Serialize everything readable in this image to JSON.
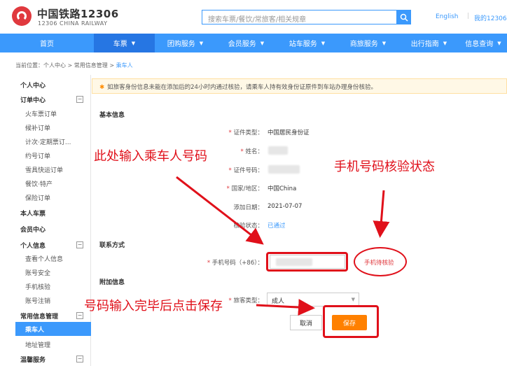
{
  "header": {
    "logo_cn": "中国铁路12306",
    "logo_en": "12306 CHINA RAILWAY",
    "search_placeholder": "搜索车票/餐饮/常旅客/相关规章",
    "english_link": "English",
    "my_link": "我的12306"
  },
  "nav": {
    "items": [
      {
        "label": "首页",
        "has_chevron": false
      },
      {
        "label": "车票",
        "has_chevron": true
      },
      {
        "label": "团购服务",
        "has_chevron": true
      },
      {
        "label": "会员服务",
        "has_chevron": true
      },
      {
        "label": "站车服务",
        "has_chevron": true
      },
      {
        "label": "商旅服务",
        "has_chevron": true
      },
      {
        "label": "出行指南",
        "has_chevron": true
      },
      {
        "label": "信息查询",
        "has_chevron": true
      }
    ]
  },
  "breadcrumb": {
    "prefix": "当前位置：个人中心 > 常用信息管理 > ",
    "current": "乘车人"
  },
  "sidebar": {
    "personal_center": "个人中心",
    "order_center": "订单中心",
    "order_items": [
      "火车票订单",
      "候补订单",
      "计次·定期票订...",
      "约号订单",
      "雪具快运订单",
      "餐饮·特产",
      "保险订单"
    ],
    "my_tickets": "本人车票",
    "member_center": "会员中心",
    "personal_info": "个人信息",
    "info_items": [
      "查看个人信息",
      "账号安全",
      "手机核验",
      "账号注销"
    ],
    "common_info": "常用信息管理",
    "passenger": "乘车人",
    "address": "地址管理",
    "warm_service": "温馨服务",
    "toggle": "−"
  },
  "notice": {
    "text": "如旅客身份信息未能在添加后的24小时内通过核验，请乘车人持有效身份证原件到车站办理身份核验。"
  },
  "form": {
    "basic_title": "基本信息",
    "id_type_label": "证件类型：",
    "id_type_value": "中国居民身份证",
    "name_label": "姓名：",
    "id_no_label": "证件号码：",
    "country_label": "国家/地区：",
    "country_value": "中国China",
    "add_date_label": "添加日期：",
    "add_date_value": "2021-07-07",
    "verify_label": "核验状态：",
    "verify_value": "已通过",
    "contact_title": "联系方式",
    "phone_label": "手机号码（+86）：",
    "phone_status": "手机待核验",
    "extra_title": "附加信息",
    "ticket_type_label": "旅客类型：",
    "ticket_type_value": "成人",
    "cancel": "取消",
    "save": "保存"
  },
  "annotations": {
    "input_hint": "此处输入乘车人号码",
    "status_hint": "手机号码核验状态",
    "save_hint": "号码输入完毕后点击保存"
  },
  "colors": {
    "brand_blue": "#3b99fc",
    "annotation_red": "#e0101a",
    "save_orange": "#ff8000"
  }
}
